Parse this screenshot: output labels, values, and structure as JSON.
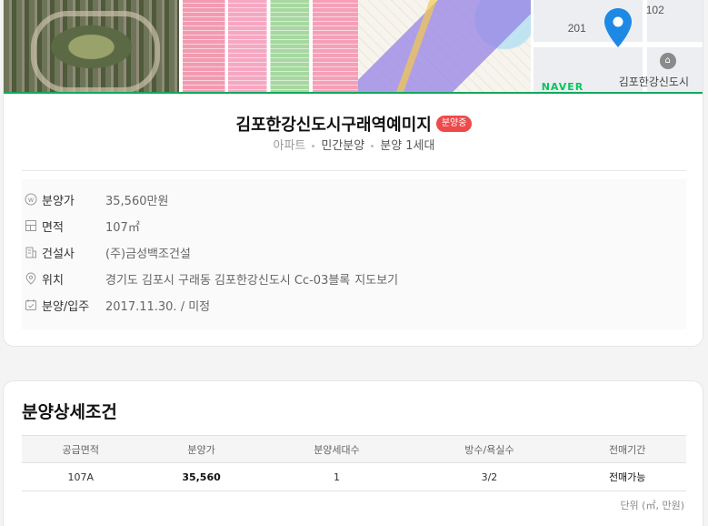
{
  "listing": {
    "title": "김포한강신도시구래역예미지",
    "status_badge": "분양중",
    "type": "아파트",
    "sale_type": "민간분양",
    "households": "분양 1세대"
  },
  "map": {
    "label_201": "201",
    "label_102": "102",
    "place_label": "김포한강신도시",
    "brand": "NAVER"
  },
  "info": [
    {
      "key": "분양가",
      "value": "35,560만원",
      "icon": "won-icon"
    },
    {
      "key": "면적",
      "value": "107㎡",
      "icon": "area-icon"
    },
    {
      "key": "건설사",
      "value": "(주)금성백조건설",
      "icon": "building-icon"
    },
    {
      "key": "위치",
      "value": "경기도 김포시 구래동 김포한강신도시 Cc-03블록",
      "link": "지도보기",
      "icon": "location-pin-icon"
    },
    {
      "key": "분양/입주",
      "value": "2017.11.30. / 미정",
      "icon": "calendar-check-icon"
    }
  ],
  "detail": {
    "title": "분양상세조건",
    "headers": [
      "공급면적",
      "분양가",
      "분양세대수",
      "방수/욕실수",
      "전매기간"
    ],
    "rows": [
      [
        "107A",
        "35,560",
        "1",
        "3/2",
        "전매가능"
      ]
    ],
    "unit_note": "단위 (㎡, 만원)"
  },
  "colors": {
    "accent_green": "#14a85b",
    "badge_red": "#ee4a4a",
    "map_pin_blue": "#1e88e5"
  }
}
